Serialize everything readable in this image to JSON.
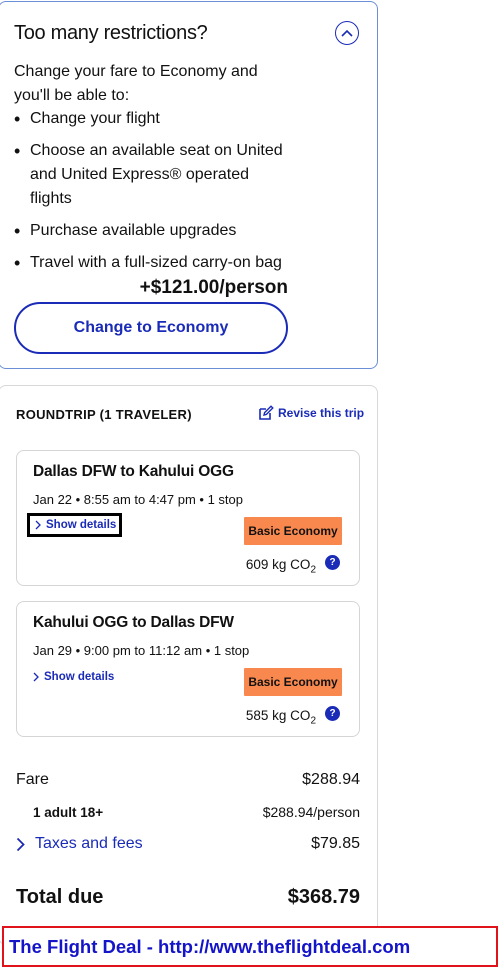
{
  "promo": {
    "title": "Too many restrictions?",
    "lead": "Change your fare to Economy and you'll be able to:",
    "benefits": [
      "Change your flight",
      "Choose an available seat on United and United Express® operated flights",
      "Purchase available upgrades",
      "Travel with a full-sized carry-on bag"
    ],
    "price": "+$121.00/person",
    "cta": "Change to Economy"
  },
  "trip": {
    "header": "ROUNDTRIP (1 TRAVELER)",
    "revise": "Revise this trip",
    "flights": [
      {
        "route": "Dallas DFW to Kahului OGG",
        "times": "Jan 22 • 8:55 am to 4:47 pm • 1 stop",
        "details_link": "Show details",
        "fare_class": "Basic Economy",
        "co2_value": "609 kg CO",
        "co2_sub": "2",
        "info": "?"
      },
      {
        "route": "Kahului OGG to Dallas DFW",
        "times": "Jan 29 • 9:00 pm to 11:12 am • 1 stop",
        "details_link": "Show details",
        "fare_class": "Basic Economy",
        "co2_value": "585 kg CO",
        "co2_sub": "2",
        "info": "?"
      }
    ],
    "summary": {
      "fare_label": "Fare",
      "fare_value": "$288.94",
      "adult_label": "1 adult 18+",
      "adult_value": "$288.94/person",
      "taxes_label": "Taxes and fees",
      "taxes_value": "$79.85",
      "total_label": "Total due",
      "total_value": "$368.79"
    }
  },
  "banner": {
    "text": "The Flight Deal - http://www.theflightdeal.com"
  },
  "colors": {
    "brand_blue": "#1a2bb8",
    "chip_orange": "#f9884f",
    "banner_red": "#e0131b"
  }
}
